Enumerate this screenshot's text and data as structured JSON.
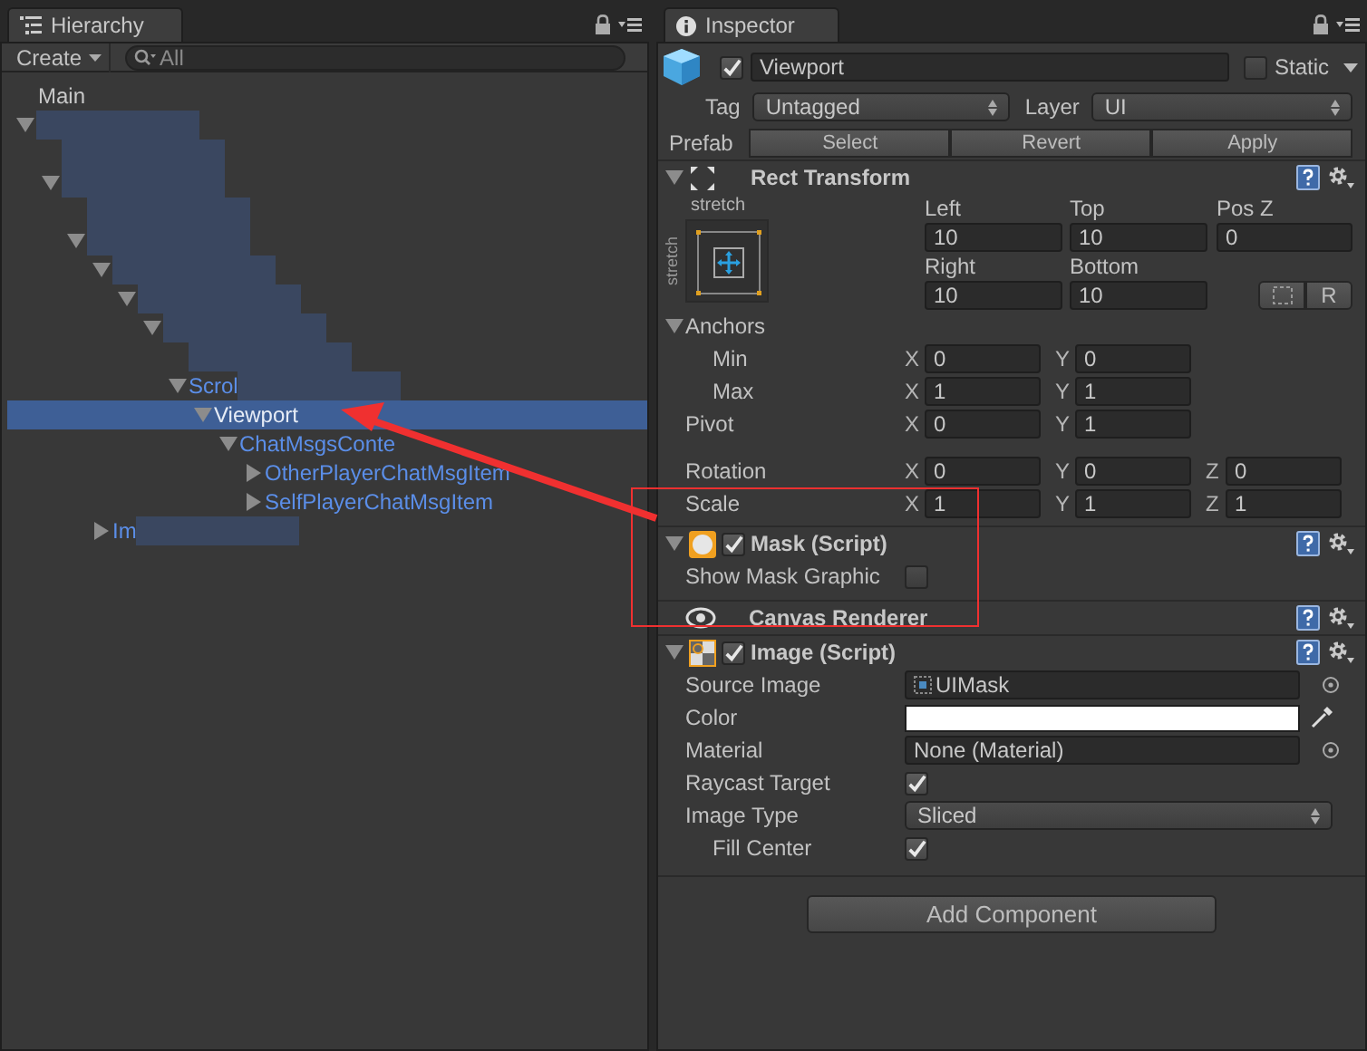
{
  "hierarchy": {
    "tab": "Hierarchy",
    "create_button": "Create",
    "search": {
      "placeholder": "All"
    },
    "tree": [
      {
        "label": "Main",
        "kind": "scene",
        "selected": false,
        "children": [
          {
            "redacted": true,
            "expanded": true,
            "selected": false,
            "children": [
              {
                "redacted": true,
                "selected": false
              },
              {
                "redacted": true,
                "expanded": true,
                "selected": false,
                "children": [
                  {
                    "redacted": true,
                    "selected": false
                  },
                  {
                    "redacted": true,
                    "expanded": true,
                    "selected": false,
                    "children": [
                      {
                        "redacted": true,
                        "expanded": true,
                        "selected": false,
                        "children": [
                          {
                            "redacted": true,
                            "expanded": true,
                            "selected": false,
                            "children": [
                              {
                                "redacted": true,
                                "expanded": true,
                                "selected": false,
                                "children": [
                                  {
                                    "redacted": true,
                                    "selected": false
                                  },
                                  {
                                    "label": "Scrol",
                                    "redacted": true,
                                    "expanded": true,
                                    "selected": false,
                                    "children": [
                                      {
                                        "label": "Viewport",
                                        "expanded": true,
                                        "selected": true,
                                        "children": [
                                          {
                                            "label": "ChatMsgsConte",
                                            "expanded": true,
                                            "selected": false,
                                            "children": [
                                              {
                                                "label": "OtherPlayerChatMsgItem",
                                                "expanded": false,
                                                "selected": false
                                              },
                                              {
                                                "label": "SelfPlayerChatMsgItem",
                                                "expanded": false,
                                                "selected": false
                                              }
                                            ]
                                          }
                                        ]
                                      }
                                    ]
                                  }
                                ]
                              }
                            ]
                          }
                        ]
                      },
                      {
                        "label": "Im",
                        "redacted": true,
                        "expanded": false,
                        "selected": false
                      }
                    ]
                  }
                ]
              }
            ]
          }
        ]
      }
    ]
  },
  "inspector": {
    "tab": "Inspector",
    "object": {
      "active": true,
      "name": "Viewport",
      "static": false,
      "static_label": "Static"
    },
    "tag": {
      "label": "Tag",
      "value": "Untagged"
    },
    "layer": {
      "label": "Layer",
      "value": "UI"
    },
    "prefab": {
      "label": "Prefab",
      "buttons": [
        "Select",
        "Revert",
        "Apply"
      ]
    },
    "components": [
      {
        "kind": "rect_transform",
        "title": "Rect Transform",
        "expanded": true,
        "preset": {
          "horizontal": "stretch",
          "vertical": "stretch"
        },
        "offsets": [
          {
            "label": "Left",
            "value": "10"
          },
          {
            "label": "Top",
            "value": "10"
          },
          {
            "label": "Pos Z",
            "value": "0"
          },
          {
            "label": "Right",
            "value": "10"
          },
          {
            "label": "Bottom",
            "value": "10"
          }
        ],
        "raw_button": "R",
        "vectors": [
          {
            "label": "Anchors",
            "expanded": true,
            "children": [
              {
                "label": "Min",
                "fields": [
                  {
                    "axis": "X",
                    "value": "0"
                  },
                  {
                    "axis": "Y",
                    "value": "0"
                  }
                ]
              },
              {
                "label": "Max",
                "fields": [
                  {
                    "axis": "X",
                    "value": "1"
                  },
                  {
                    "axis": "Y",
                    "value": "1"
                  }
                ]
              }
            ]
          },
          {
            "label": "Pivot",
            "fields": [
              {
                "axis": "X",
                "value": "0"
              },
              {
                "axis": "Y",
                "value": "1"
              }
            ]
          },
          {
            "label": "Rotation",
            "fields": [
              {
                "axis": "X",
                "value": "0"
              },
              {
                "axis": "Y",
                "value": "0"
              },
              {
                "axis": "Z",
                "value": "0"
              }
            ]
          },
          {
            "label": "Scale",
            "fields": [
              {
                "axis": "X",
                "value": "1"
              },
              {
                "axis": "Y",
                "value": "1"
              },
              {
                "axis": "Z",
                "value": "1"
              }
            ]
          }
        ]
      },
      {
        "kind": "mask",
        "title": "Mask (Script)",
        "expanded": true,
        "enabled": true,
        "properties": [
          {
            "kind": "checkbox",
            "label": "Show Mask Graphic",
            "checked": false
          }
        ]
      },
      {
        "kind": "canvas_renderer",
        "title": "Canvas Renderer"
      },
      {
        "kind": "image",
        "title": "Image (Script)",
        "expanded": true,
        "enabled": true,
        "properties": [
          {
            "kind": "object",
            "label": "Source Image",
            "value": "UIMask",
            "sprite": true
          },
          {
            "kind": "color",
            "label": "Color",
            "color": "#ffffff"
          },
          {
            "kind": "object",
            "label": "Material",
            "value": "None (Material)"
          },
          {
            "kind": "checkbox",
            "label": "Raycast Target",
            "checked": true
          },
          {
            "kind": "dropdown",
            "label": "Image Type",
            "value": "Sliced",
            "children": [
              {
                "kind": "checkbox",
                "label": "Fill Center",
                "checked": true
              }
            ]
          }
        ]
      }
    ],
    "add_component_button": "Add Component"
  },
  "annotations": {
    "arrow": true,
    "box": true
  }
}
